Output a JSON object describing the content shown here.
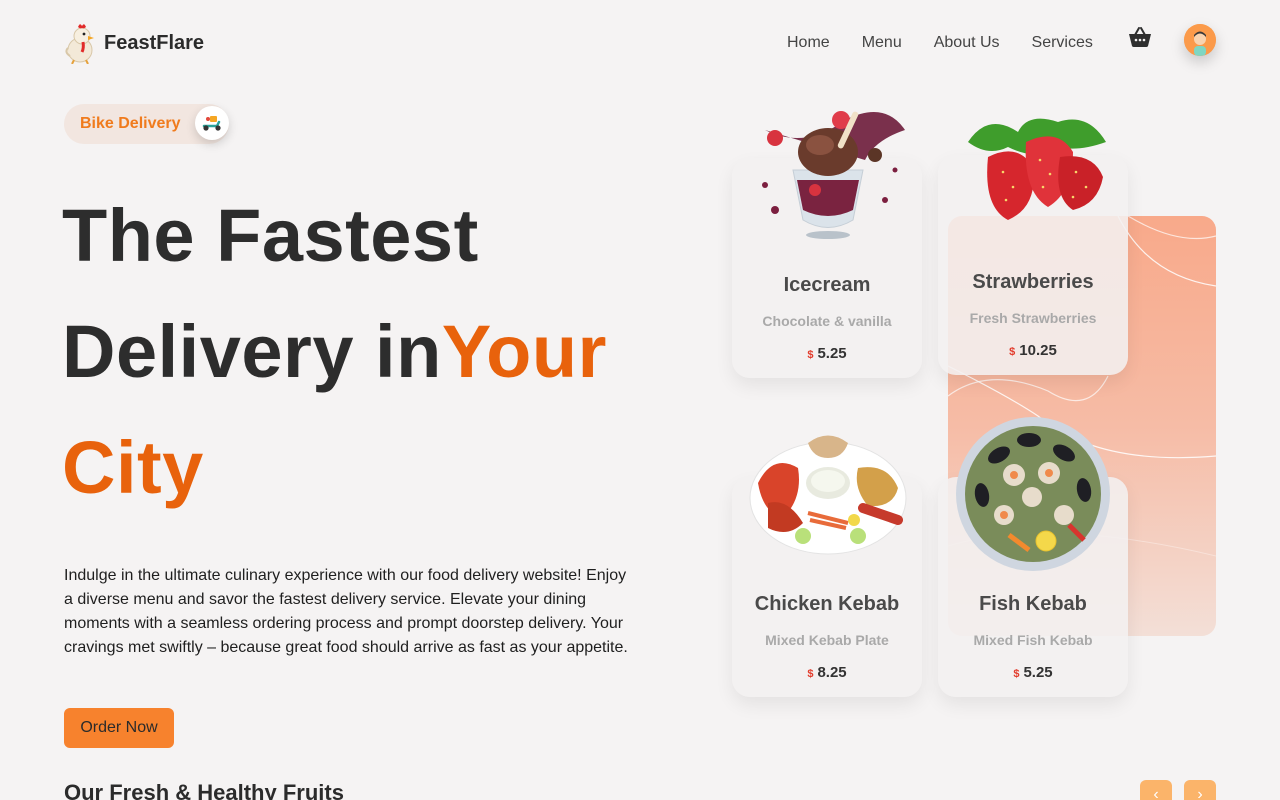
{
  "header": {
    "brand": "FeastFlare",
    "nav": [
      "Home",
      "Menu",
      "About Us",
      "Services"
    ]
  },
  "hero": {
    "badge": "Bike Delivery",
    "title_line1": "The Fastest",
    "title_line2_plain": "Delivery in",
    "title_line2_accent": "Your",
    "title_line3_accent": "City",
    "description": "Indulge in the ultimate culinary experience with our food delivery website! Enjoy a diverse menu and savor the fastest delivery service. Elevate your dining moments with a seamless ordering process and prompt doorstep delivery. Your cravings met swiftly – because great food should arrive as fast as your appetite.",
    "cta": "Order Now"
  },
  "section": {
    "title": "Our Fresh & Healthy Fruits",
    "prev": "‹",
    "next": "›"
  },
  "products": [
    {
      "name": "Icecream",
      "desc": "Chocolate & vanilla",
      "currency": "$",
      "price": "5.25"
    },
    {
      "name": "Strawberries",
      "desc": "Fresh Strawberries",
      "currency": "$",
      "price": "10.25"
    },
    {
      "name": "Chicken Kebab",
      "desc": "Mixed Kebab Plate",
      "currency": "$",
      "price": "8.25"
    },
    {
      "name": "Fish Kebab",
      "desc": "Mixed Fish Kebab",
      "currency": "$",
      "price": "5.25"
    }
  ],
  "icons": {
    "logo": "chicken-mascot-icon",
    "cart": "basket-icon",
    "avatar": "user-avatar",
    "badge": "scooter-icon"
  },
  "colors": {
    "accent": "#e8620c",
    "button": "#f7822d",
    "background": "#f5f3f3",
    "panel": "#f8a98a"
  }
}
